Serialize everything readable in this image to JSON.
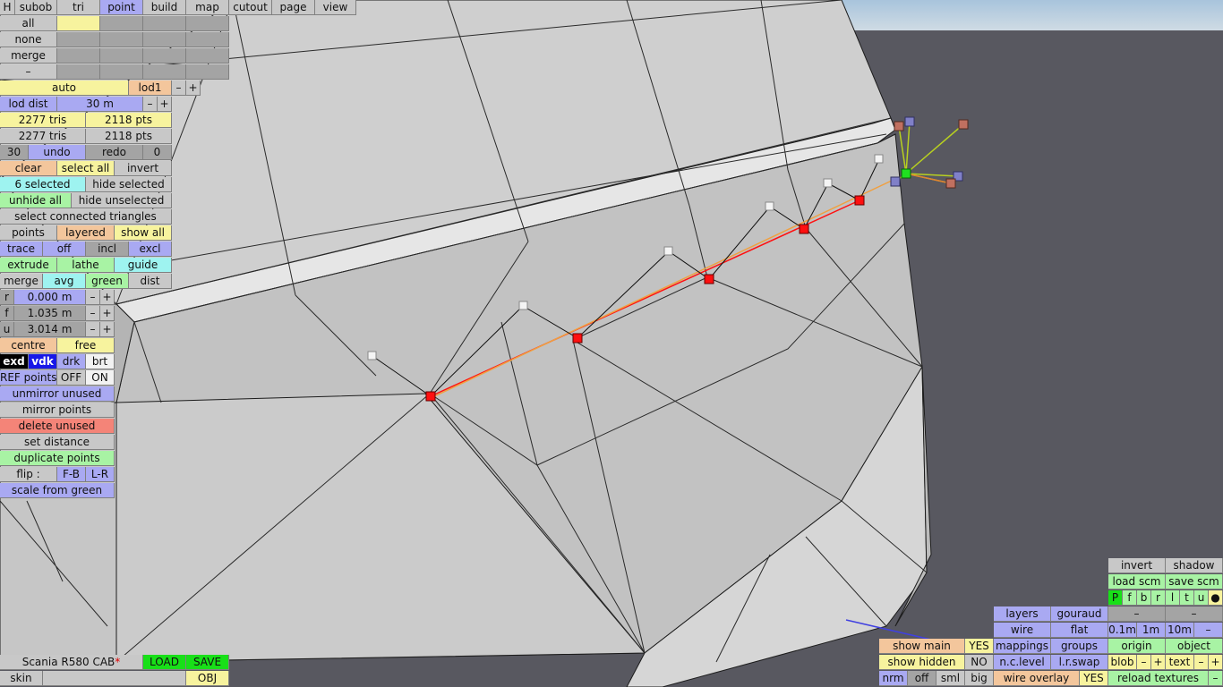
{
  "menu": {
    "h": "H",
    "tabs": [
      "subob",
      "tri",
      "point",
      "build",
      "map",
      "cutout",
      "page",
      "view"
    ],
    "active_tab": "point"
  },
  "select_rows": [
    "all",
    "none",
    "merge",
    "–"
  ],
  "lod": {
    "auto": "auto",
    "lod1": "lod1",
    "minus": "–",
    "plus": "+",
    "dist_label": "lod dist",
    "dist_value": "30 m"
  },
  "stats": {
    "tris1": "2277 tris",
    "pts1": "2118 pts",
    "tris2": "2277 tris",
    "pts2": "2118 pts"
  },
  "history": {
    "count": "30",
    "undo": "undo",
    "redo": "redo",
    "redo_count": "0"
  },
  "selection": {
    "clear": "clear",
    "select_all": "select all",
    "invert": "invert",
    "selected": "6 selected",
    "hide_selected": "hide selected",
    "unhide_all": "unhide all",
    "hide_unselected": "hide unselected",
    "select_connected": "select connected triangles"
  },
  "display": {
    "points": "points",
    "layered": "layered",
    "show_all": "show all"
  },
  "trace": {
    "trace": "trace",
    "off": "off",
    "incl": "incl",
    "excl": "excl"
  },
  "ops": {
    "extrude": "extrude",
    "lathe": "lathe",
    "guide": "guide",
    "merge": "merge",
    "avg": "avg",
    "green": "green",
    "dist": "dist"
  },
  "coords": [
    {
      "axis": "r",
      "value": "0.000 m"
    },
    {
      "axis": "f",
      "value": "1.035 m"
    },
    {
      "axis": "u",
      "value": "3.014 m"
    }
  ],
  "pivot": {
    "centre": "centre",
    "free": "free"
  },
  "modes": {
    "exd": "exd",
    "vdk": "vdk",
    "drk": "drk",
    "brt": "brt"
  },
  "ref": {
    "label": "REF points",
    "off": "OFF",
    "on": "ON"
  },
  "actions": {
    "unmirror_unused": "unmirror unused",
    "mirror_points": "mirror points",
    "delete_unused": "delete unused",
    "set_distance": "set distance",
    "duplicate_points": "duplicate points",
    "flip": "flip :",
    "flip_fb": "F-B",
    "flip_lr": "L-R",
    "scale_from_green": "scale from green"
  },
  "file": {
    "name": "Scania R580 CAB",
    "modified_mark": "*",
    "load": "LOAD",
    "save": "SAVE",
    "skin": "skin",
    "obj": "OBJ"
  },
  "bottom_right": {
    "invert": "invert",
    "shadow": "shadow",
    "load_scm": "load scm",
    "save_scm": "save scm",
    "views": [
      "P",
      "f",
      "b",
      "r",
      "l",
      "t",
      "u",
      "●"
    ],
    "layers": "layers",
    "gouraud": "gouraud",
    "dash1": "–",
    "dash2": "–",
    "wire": "wire",
    "flat": "flat",
    "step1": "0.1m",
    "step2": "1m",
    "step3": "10m",
    "step_minus": "–",
    "show_main": "show main",
    "show_main_val": "YES",
    "mappings": "mappings",
    "groups": "groups",
    "origin": "origin",
    "object": "object",
    "show_hidden": "show hidden",
    "show_hidden_val": "NO",
    "nc_level": "n.c.level",
    "lr_swap": "l.r.swap",
    "blob": "blob",
    "blob_minus": "–",
    "blob_plus": "+",
    "text": "text",
    "text_minus": "–",
    "text_plus": "+",
    "nrm": "nrm",
    "off": "off",
    "sml": "sml",
    "big": "big",
    "wire_overlay": "wire overlay",
    "wire_overlay_val": "YES",
    "reload_textures": "reload textures",
    "reload_minus": "–"
  }
}
